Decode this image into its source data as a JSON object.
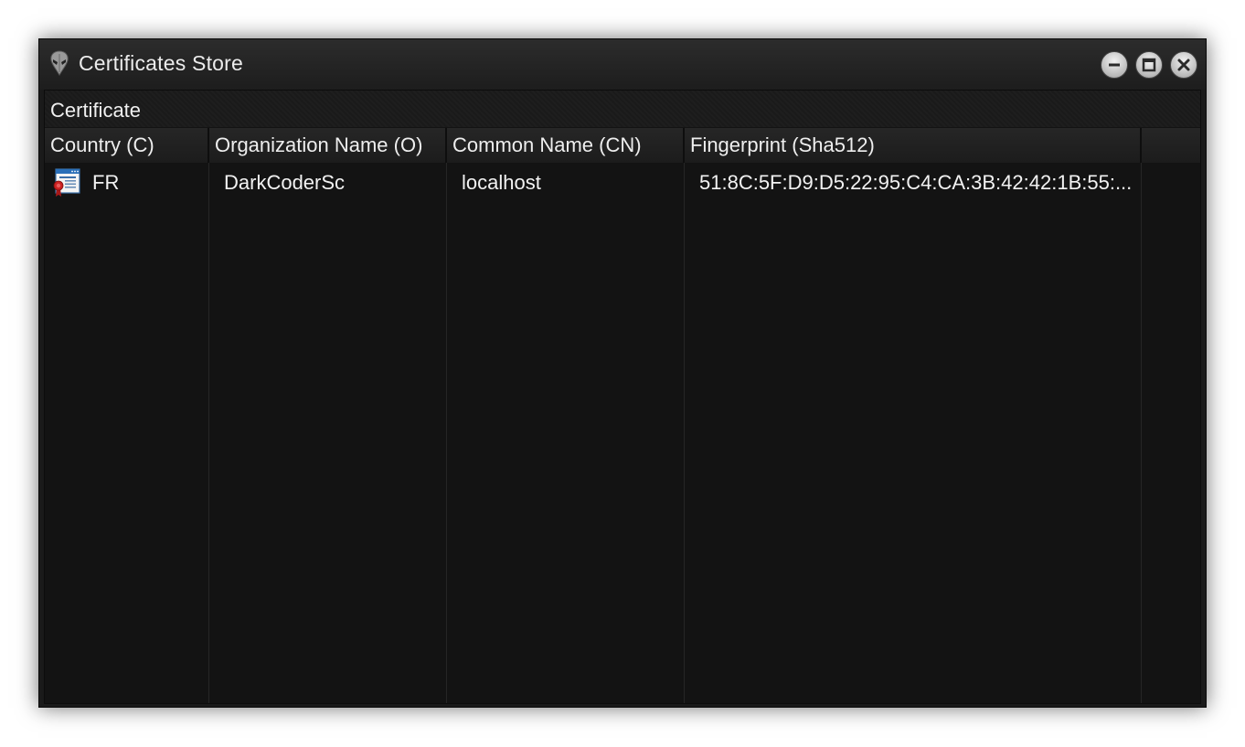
{
  "window": {
    "title": "Certificates Store",
    "app_icon": "alien-head-icon",
    "controls": [
      "minimize-icon",
      "maximize-icon",
      "close-icon"
    ]
  },
  "group": {
    "label": "Certificate"
  },
  "table": {
    "columns": [
      "Country (C)",
      "Organization Name (O)",
      "Common Name (CN)",
      "Fingerprint (Sha512)"
    ],
    "rows": [
      {
        "icon": "certificate-icon",
        "country": "FR",
        "organization": "DarkCoderSc",
        "common_name": "localhost",
        "fingerprint": "51:8C:5F:D9:D5:22:95:C4:CA:3B:42:42:1B:55:..."
      }
    ]
  },
  "colors": {
    "titlebar": "#252525",
    "content_background": "#131313",
    "text": "#f0f0f0",
    "cert_icon_red": "#cc2222",
    "cert_icon_blue": "#2a6fb8"
  }
}
